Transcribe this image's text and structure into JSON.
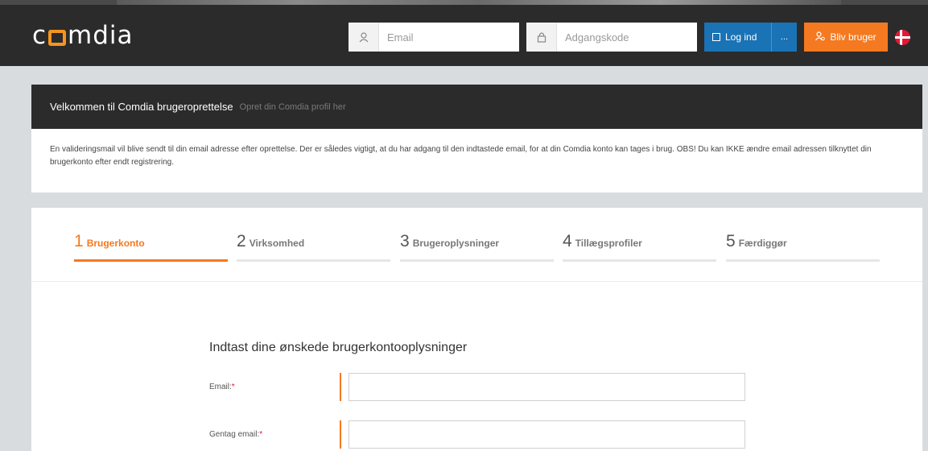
{
  "header": {
    "logo_left": "c",
    "logo_right": "mdia",
    "email_placeholder": "Email",
    "password_placeholder": "Adgangskode",
    "login_label": "Log ind",
    "login_more": "...",
    "signup_label": "Bliv bruger",
    "language_flag": "danish-flag-icon"
  },
  "welcome": {
    "title": "Velkommen til Comdia brugeroprettelse",
    "subtitle": "Opret din Comdia profil her",
    "text": "En valideringsmail vil blive sendt til din email adresse efter oprettelse. Der er således vigtigt, at du har adgang til den indtastede email, for at din Comdia konto kan tages i brug. OBS! Du kan IKKE ændre email adressen tilknyttet din brugerkonto efter endt registrering."
  },
  "steps": [
    {
      "number": "1",
      "label": "Brugerkonto",
      "active": true
    },
    {
      "number": "2",
      "label": "Virksomhed",
      "active": false
    },
    {
      "number": "3",
      "label": "Brugeroplysninger",
      "active": false
    },
    {
      "number": "4",
      "label": "Tillægsprofiler",
      "active": false
    },
    {
      "number": "5",
      "label": "Færdiggør",
      "active": false
    }
  ],
  "form": {
    "title": "Indtast dine ønskede brugerkontooplysninger",
    "fields": [
      {
        "label": "Email:",
        "required": "*",
        "value": ""
      },
      {
        "label": "Gentag email:",
        "required": "*",
        "value": ""
      }
    ]
  },
  "colors": {
    "accent": "#f47920",
    "primary_blue": "#1a73b5",
    "dark_bar": "#2b2b2b"
  }
}
